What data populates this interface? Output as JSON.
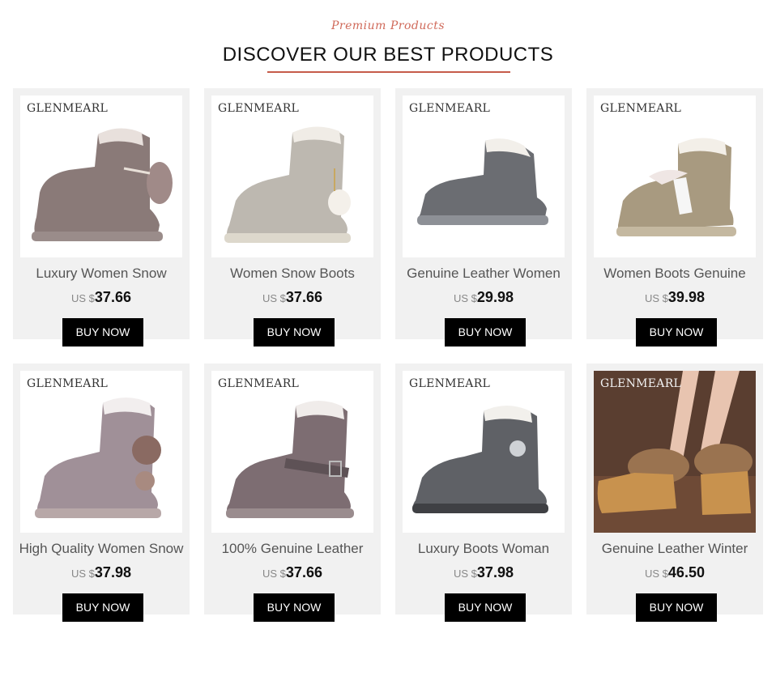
{
  "header": {
    "script_title": "Premium Products",
    "title": "DISCOVER OUR BEST PRODUCTS"
  },
  "products": [
    {
      "brand": "GLENMEARL",
      "name": "Luxury Women Snow",
      "currency": "US $",
      "price": "37.66",
      "buy_label": "BUY NOW",
      "color": "#8a7a78"
    },
    {
      "brand": "GLENMEARL",
      "name": "Women Snow Boots",
      "currency": "US $",
      "price": "37.66",
      "buy_label": "BUY NOW",
      "color": "#bdb8b0"
    },
    {
      "brand": "GLENMEARL",
      "name": "Genuine Leather Women",
      "currency": "US $",
      "price": "29.98",
      "buy_label": "BUY NOW",
      "color": "#6b6d72"
    },
    {
      "brand": "GLENMEARL",
      "name": "Women Boots Genuine",
      "currency": "US $",
      "price": "39.98",
      "buy_label": "BUY NOW",
      "color": "#a89a80"
    },
    {
      "brand": "GLENMEARL",
      "name": "High Quality Women Snow",
      "currency": "US $",
      "price": "37.98",
      "buy_label": "BUY NOW",
      "color": "#a09098"
    },
    {
      "brand": "GLENMEARL",
      "name": "100% Genuine Leather",
      "currency": "US $",
      "price": "37.66",
      "buy_label": "BUY NOW",
      "color": "#7d6d72"
    },
    {
      "brand": "GLENMEARL",
      "name": "Luxury Boots Woman",
      "currency": "US $",
      "price": "37.98",
      "buy_label": "BUY NOW",
      "color": "#5f6166"
    },
    {
      "brand": "GLENMEARL",
      "name": "Genuine Leather Winter",
      "currency": "US $",
      "price": "46.50",
      "buy_label": "BUY NOW",
      "color": "#b98a55"
    }
  ],
  "colors": {
    "accent": "#c65b4a",
    "card_bg": "#f1f1f1",
    "button_bg": "#000000"
  }
}
